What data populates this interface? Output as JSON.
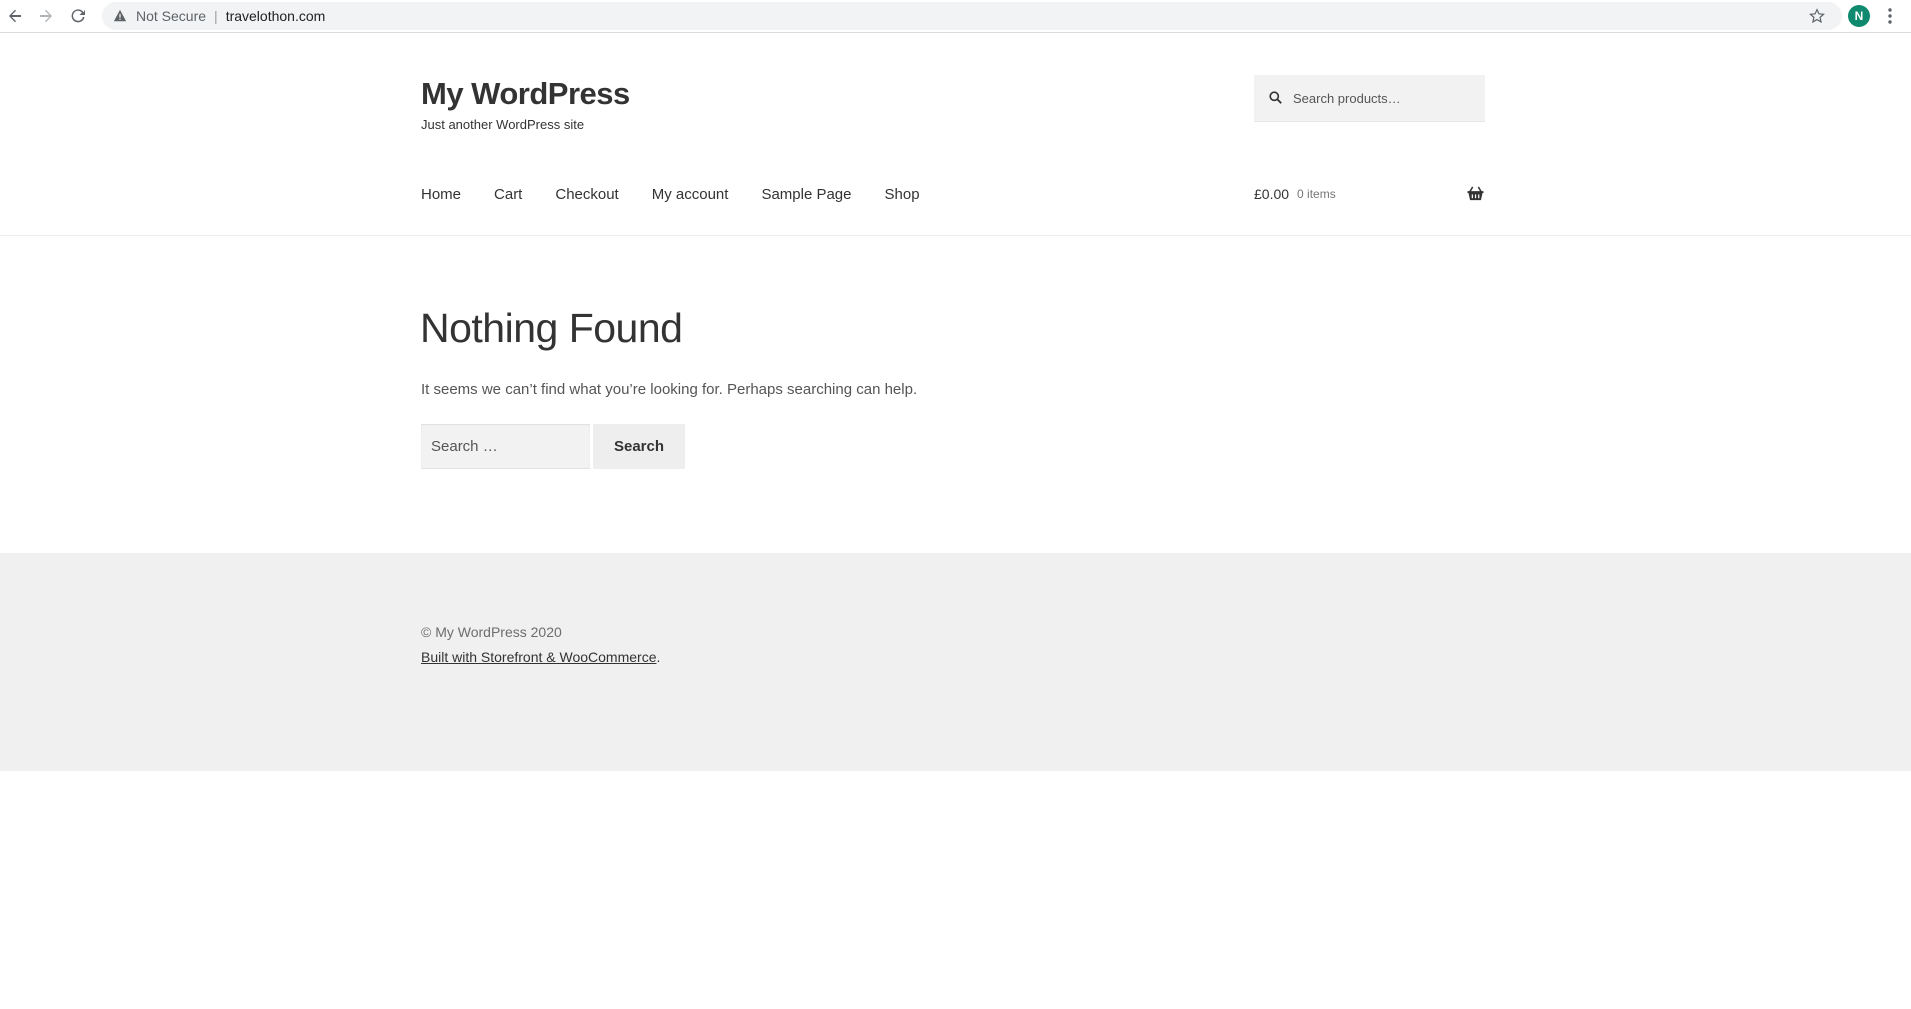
{
  "browser": {
    "security_label": "Not Secure",
    "separator": "|",
    "url": "travelothon.com",
    "profile_initial": "N",
    "colors": {
      "avatar": "#0f8a6e",
      "omnibox": "#f1f3f4"
    }
  },
  "header": {
    "site_title": "My WordPress",
    "tagline": "Just another WordPress site",
    "product_search_placeholder": "Search products…",
    "nav": [
      "Home",
      "Cart",
      "Checkout",
      "My account",
      "Sample Page",
      "Shop"
    ],
    "cart": {
      "amount": "£0.00",
      "items": "0 items"
    }
  },
  "main": {
    "title": "Nothing Found",
    "message": "It seems we can’t find what you’re looking for. Perhaps searching can help.",
    "search_placeholder": "Search …",
    "search_button": "Search"
  },
  "footer": {
    "copyright": "© My WordPress 2020",
    "credit_link": "Built with Storefront & WooCommerce",
    "credit_suffix": "."
  },
  "icons": {
    "back": "arrow-left-icon",
    "forward": "arrow-right-icon",
    "reload": "reload-icon",
    "warning": "warning-icon",
    "star": "star-icon",
    "menu": "kebab-menu-icon",
    "search": "search-icon",
    "basket": "basket-icon"
  }
}
